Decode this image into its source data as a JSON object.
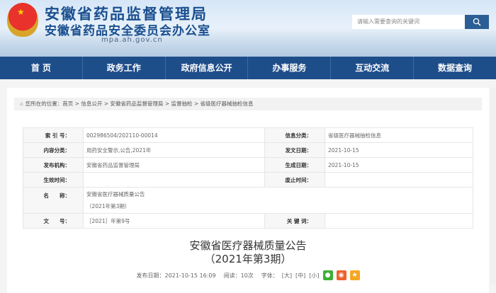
{
  "header": {
    "title1": "安徽省药品监督管理局",
    "title2": "安徽省药品安全委员会办公室",
    "url": "mpa.ah.gov.cn",
    "search_placeholder": "请输入需要查询的关键词"
  },
  "nav": [
    "首 页",
    "政务工作",
    "政府信息公开",
    "办事服务",
    "互动交流",
    "数据查询"
  ],
  "breadcrumb": {
    "prefix": "您所在的位置：",
    "items": [
      "首页",
      "信息公开",
      "安徽省药品监督管理局",
      "监督抽检",
      "省级医疗器械抽检信息"
    ],
    "sep": " > "
  },
  "info": {
    "index_label": "索 引 号：",
    "index": "002986504/202110-00014",
    "category_label": "信息分类：",
    "category": "省级医疗器械抽检信息",
    "content_label": "内容分类：",
    "content": "用药安全警示,公告,2021年",
    "issue_date_label": "发文日期：",
    "issue_date": "2021-10-15",
    "org_label": "发布机构：",
    "org": "安徽省药品监督管理局",
    "gen_date_label": "生成日期：",
    "gen_date": "2021-10-15",
    "effective_label": "生效时间：",
    "effective": "",
    "expire_label": "废止时间：",
    "expire": "",
    "name_label": "名　　称：",
    "name_line1": "安徽省医疗器械质量公告",
    "name_line2": "（2021年第3期）",
    "docno_label": "文　　号：",
    "docno": "［2021］年第9号",
    "keywords_label": "关 键 词：",
    "keywords": ""
  },
  "article": {
    "title1": "安徽省医疗器械质量公告",
    "title2": "（2021年第3期）",
    "publish": "发布日期：2021-10-15 16:09",
    "reads": "阅读：10次",
    "font_label": "字体：",
    "font_large": "[大]",
    "font_mid": "[中]",
    "font_small": "[小]"
  }
}
